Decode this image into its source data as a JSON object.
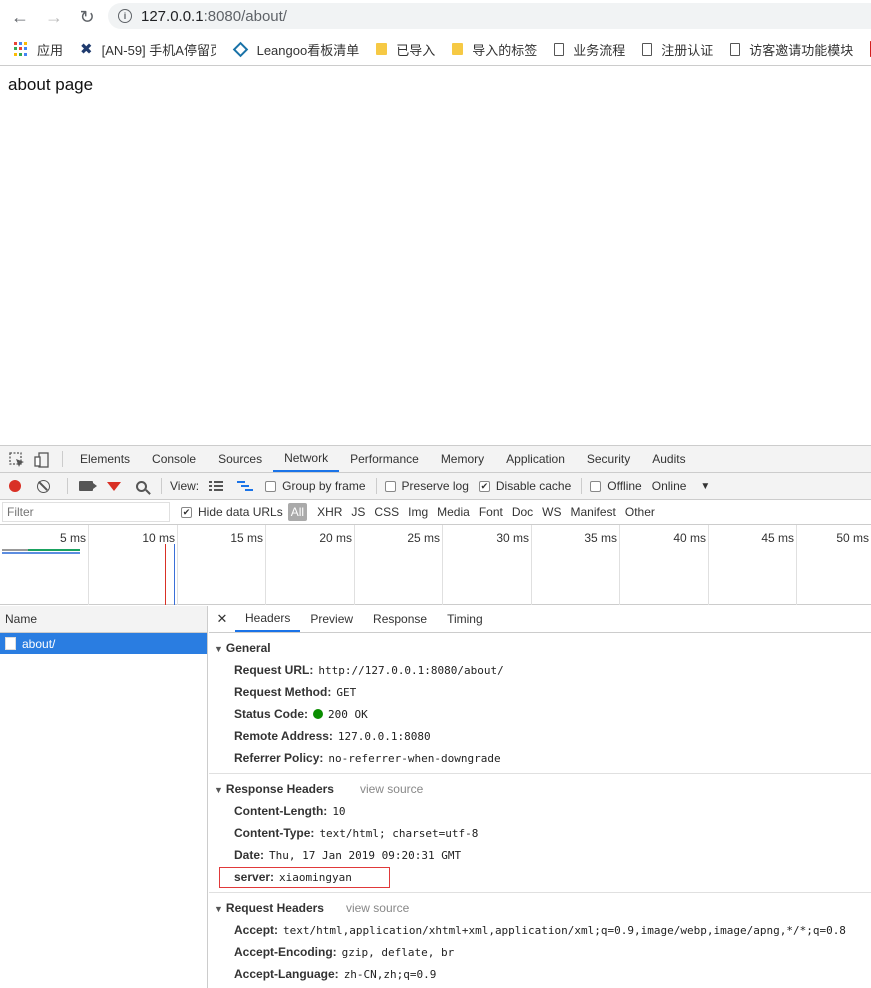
{
  "browser": {
    "url_host": "127.0.0.1",
    "url_rest": ":8080/about/",
    "bookmarks": [
      {
        "label": "应用",
        "icon": "apps-grid-icon"
      },
      {
        "label": "[AN-59] 手机A停留页",
        "icon": "jira-icon"
      },
      {
        "label": "Leangoo看板清单",
        "icon": "leangoo-icon"
      },
      {
        "label": "已导入",
        "icon": "folder-icon"
      },
      {
        "label": "导入的标签",
        "icon": "folder-icon"
      },
      {
        "label": "业务流程",
        "icon": "page-icon"
      },
      {
        "label": "注册认证",
        "icon": "page-icon"
      },
      {
        "label": "访客邀请功能模块",
        "icon": "page-icon"
      }
    ]
  },
  "page": {
    "text": "about page"
  },
  "devtools": {
    "tabs": [
      "Elements",
      "Console",
      "Sources",
      "Network",
      "Performance",
      "Memory",
      "Application",
      "Security",
      "Audits"
    ],
    "active_tab": "Network",
    "toolbar": {
      "view_label": "View:",
      "group_by_frame": "Group by frame",
      "preserve_log": "Preserve log",
      "disable_cache": "Disable cache",
      "offline": "Offline",
      "throttle": "Online"
    },
    "filter": {
      "placeholder": "Filter",
      "hide_data_urls": "Hide data URLs",
      "types": [
        "All",
        "XHR",
        "JS",
        "CSS",
        "Img",
        "Media",
        "Font",
        "Doc",
        "WS",
        "Manifest",
        "Other"
      ]
    },
    "timeline_ticks": [
      "5 ms",
      "10 ms",
      "15 ms",
      "20 ms",
      "25 ms",
      "30 ms",
      "35 ms",
      "40 ms",
      "45 ms",
      "50 ms"
    ],
    "name_header": "Name",
    "requests": [
      {
        "name": "about/"
      }
    ],
    "detail_tabs": [
      "Headers",
      "Preview",
      "Response",
      "Timing"
    ],
    "general": {
      "title": "General",
      "rows": [
        {
          "k": "Request URL:",
          "v": "http://127.0.0.1:8080/about/"
        },
        {
          "k": "Request Method:",
          "v": "GET"
        },
        {
          "k": "Status Code:",
          "v": "200 OK"
        },
        {
          "k": "Remote Address:",
          "v": "127.0.0.1:8080"
        },
        {
          "k": "Referrer Policy:",
          "v": "no-referrer-when-downgrade"
        }
      ]
    },
    "response_headers": {
      "title": "Response Headers",
      "view_source": "view source",
      "rows": [
        {
          "k": "Content-Length:",
          "v": "10"
        },
        {
          "k": "Content-Type:",
          "v": "text/html; charset=utf-8"
        },
        {
          "k": "Date:",
          "v": "Thu, 17 Jan 2019 09:20:31 GMT"
        },
        {
          "k": "server:",
          "v": "xiaomingyan"
        }
      ]
    },
    "request_headers": {
      "title": "Request Headers",
      "view_source": "view source",
      "rows": [
        {
          "k": "Accept:",
          "v": "text/html,application/xhtml+xml,application/xml;q=0.9,image/webp,image/apng,*/*;q=0.8"
        },
        {
          "k": "Accept-Encoding:",
          "v": "gzip, deflate, br"
        },
        {
          "k": "Accept-Language:",
          "v": "zh-CN,zh;q=0.9"
        }
      ]
    },
    "colors": {
      "accent": "#1a73e8",
      "selected_row": "#2a7de1",
      "record": "#d93025",
      "status_ok": "#0a8d00",
      "highlight_box": "#e0393a"
    }
  }
}
